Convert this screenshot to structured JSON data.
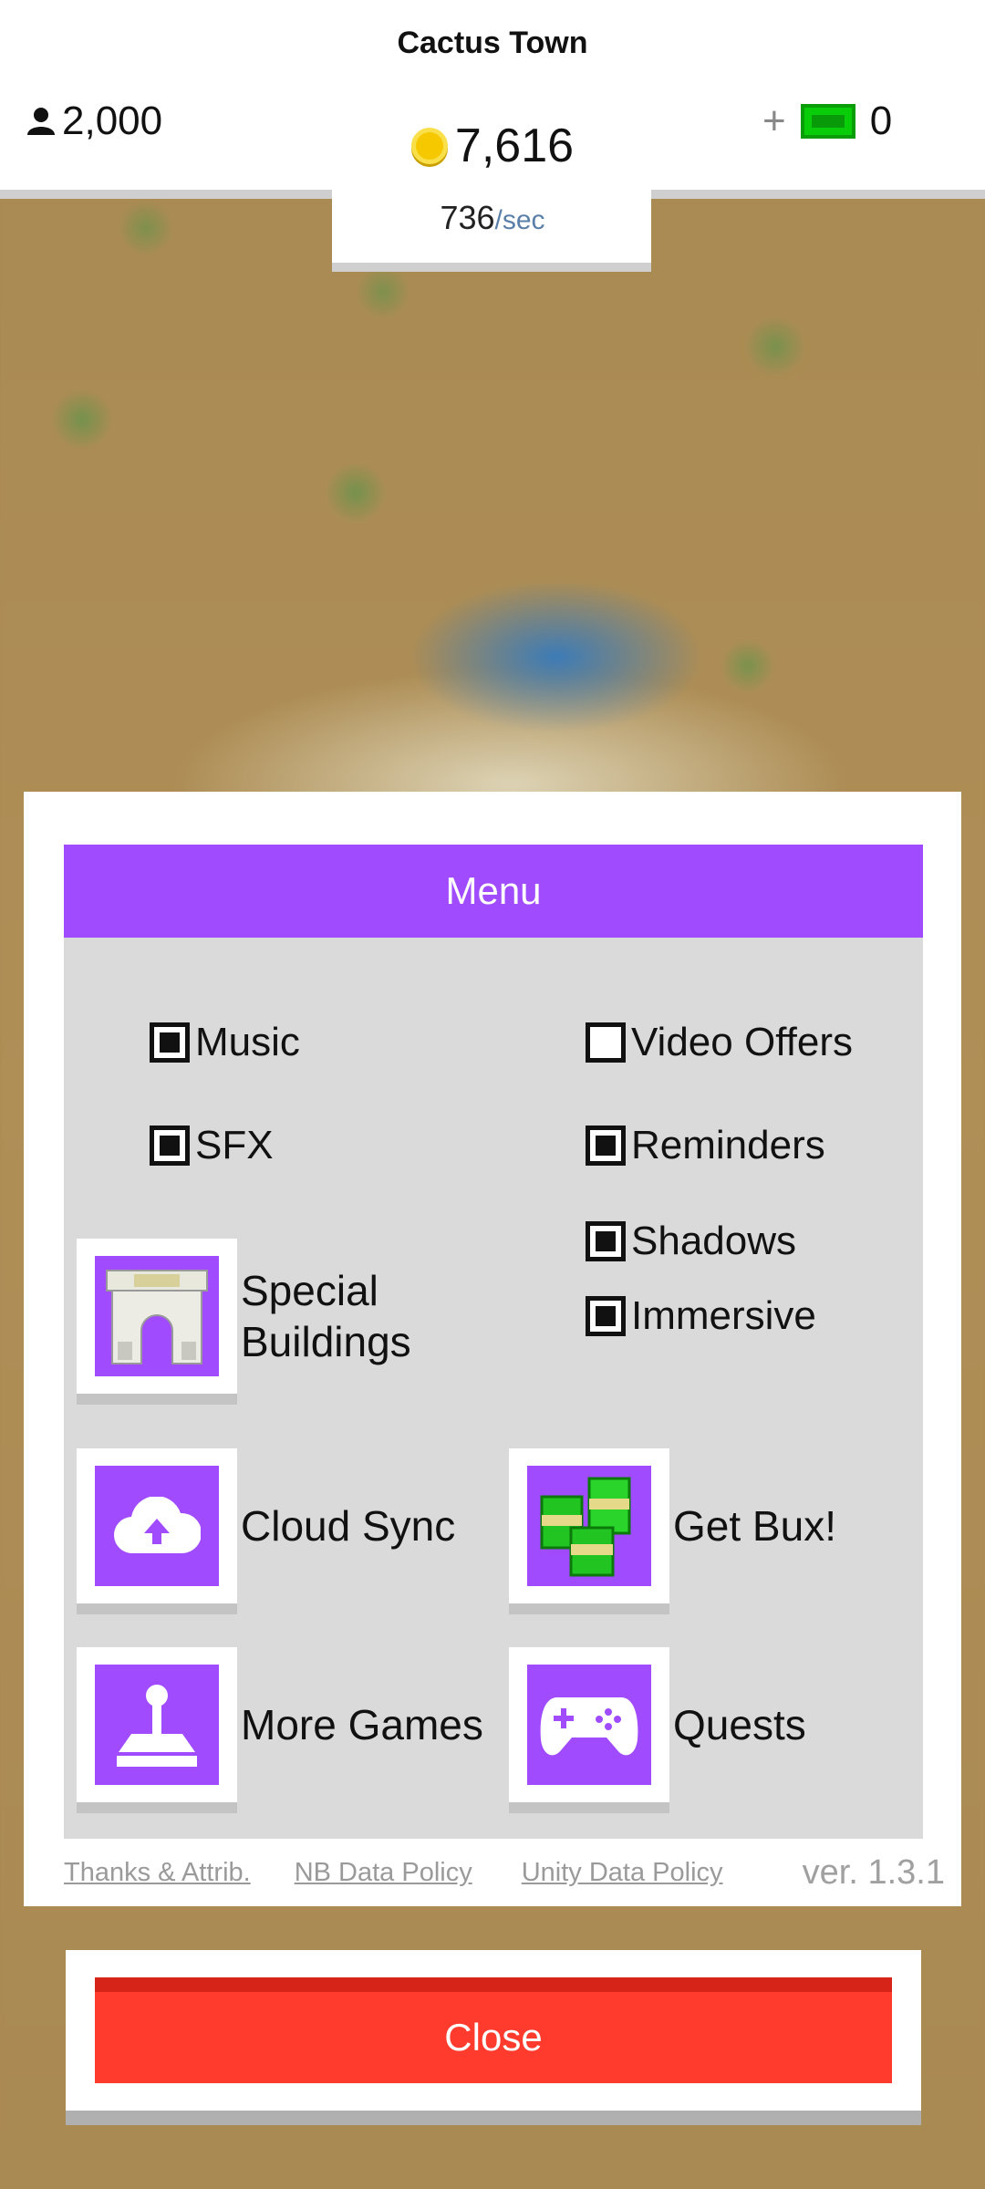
{
  "header": {
    "town_name": "Cactus Town",
    "population": "2,000",
    "coins": "7,616",
    "rate_value": "736",
    "rate_unit": "/sec",
    "plus": "+",
    "bux": "0"
  },
  "menu": {
    "title": "Menu",
    "toggles": {
      "music": {
        "label": "Music",
        "checked": true
      },
      "video_offers": {
        "label": "Video Offers",
        "checked": false
      },
      "sfx": {
        "label": "SFX",
        "checked": true
      },
      "reminders": {
        "label": "Reminders",
        "checked": true
      },
      "shadows": {
        "label": "Shadows",
        "checked": true
      },
      "immersive": {
        "label": "Immersive",
        "checked": true
      }
    },
    "tiles": {
      "special_buildings_line1": "Special",
      "special_buildings_line2": "Buildings",
      "cloud_sync": "Cloud Sync",
      "get_bux": "Get Bux!",
      "more_games": "More Games",
      "quests": "Quests"
    },
    "footer": {
      "thanks": "Thanks & Attrib.",
      "nb_policy": "NB Data Policy",
      "unity_policy": "Unity Data Policy",
      "version": "ver. 1.3.1"
    }
  },
  "close_label": "Close",
  "colors": {
    "accent_purple": "#a14bff",
    "close_red": "#ff3b2e",
    "bux_green": "#0acd0a",
    "coin_yellow": "#f6c800"
  }
}
